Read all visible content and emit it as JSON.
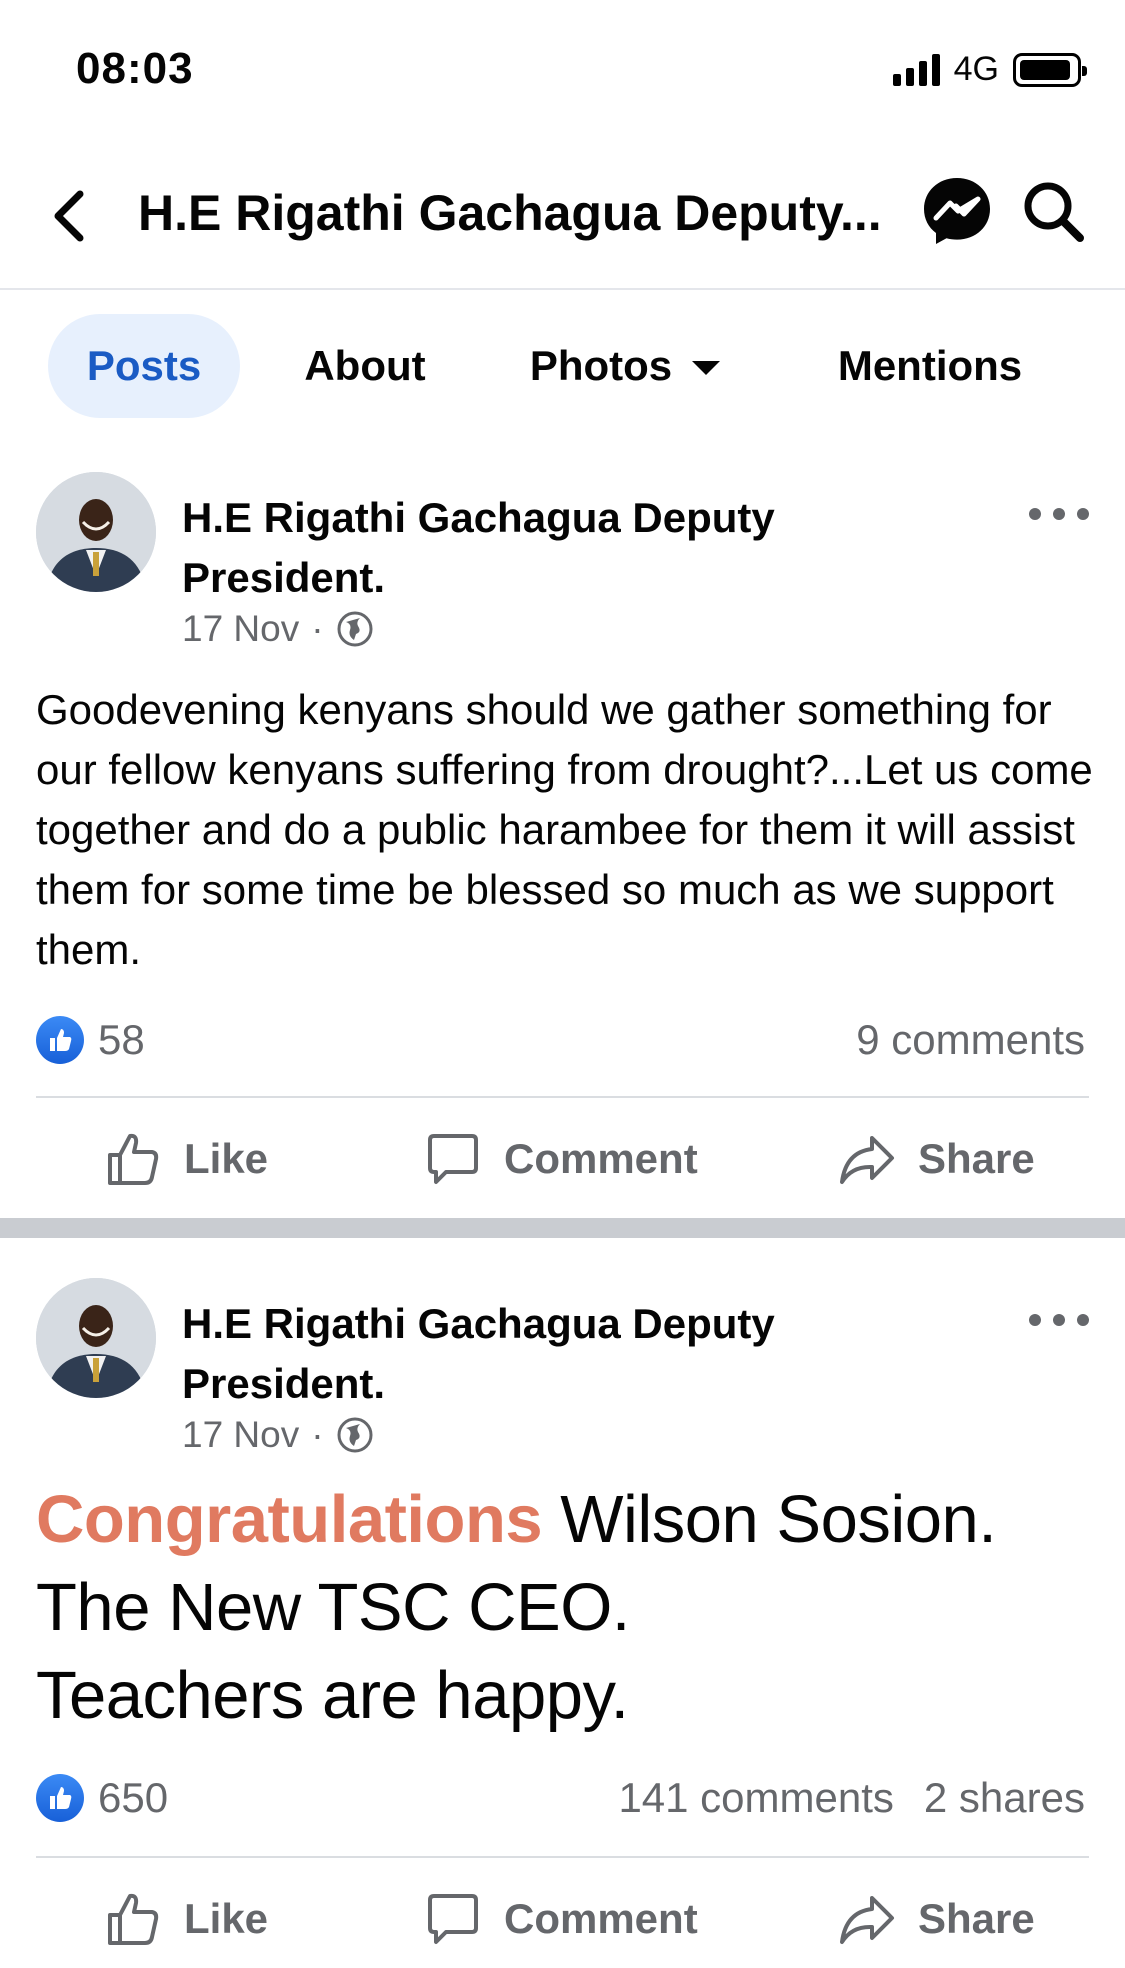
{
  "status_bar": {
    "time": "08:03",
    "network": "4G"
  },
  "header": {
    "title": "H.E Rigathi Gachagua Deputy..."
  },
  "tabs": [
    {
      "label": "Posts",
      "active": true
    },
    {
      "label": "About"
    },
    {
      "label": "Photos"
    },
    {
      "label": "Mentions"
    }
  ],
  "posts": [
    {
      "author_line1": "H.E Rigathi Gachagua Deputy",
      "author_line2": "President.",
      "date": "17 Nov",
      "text": "Goodevening kenyans should we gather something for our fellow kenyans suffering from drought?...Let us come together and do a public harambee for them it will assist them for some time be blessed so much as we support them.",
      "likes": "58",
      "comments": "9 comments",
      "actions": {
        "like": "Like",
        "comment": "Comment",
        "share": "Share"
      }
    },
    {
      "author_line1": "H.E Rigathi Gachagua Deputy",
      "author_line2": "President.",
      "date": "17 Nov",
      "text_highlight": "Congratulations",
      "text_rest": " Wilson Sosion.",
      "text_line2": "The New TSC CEO.",
      "text_line3": "Teachers are happy.",
      "likes": "650",
      "comments": "141 comments",
      "shares": "2 shares",
      "actions": {
        "like": "Like",
        "comment": "Comment",
        "share": "Share"
      }
    }
  ],
  "colors": {
    "accent": "#1a5bc4",
    "tab_active_bg": "#e7f0fd",
    "highlight": "#e07a60",
    "muted": "#65676b"
  }
}
